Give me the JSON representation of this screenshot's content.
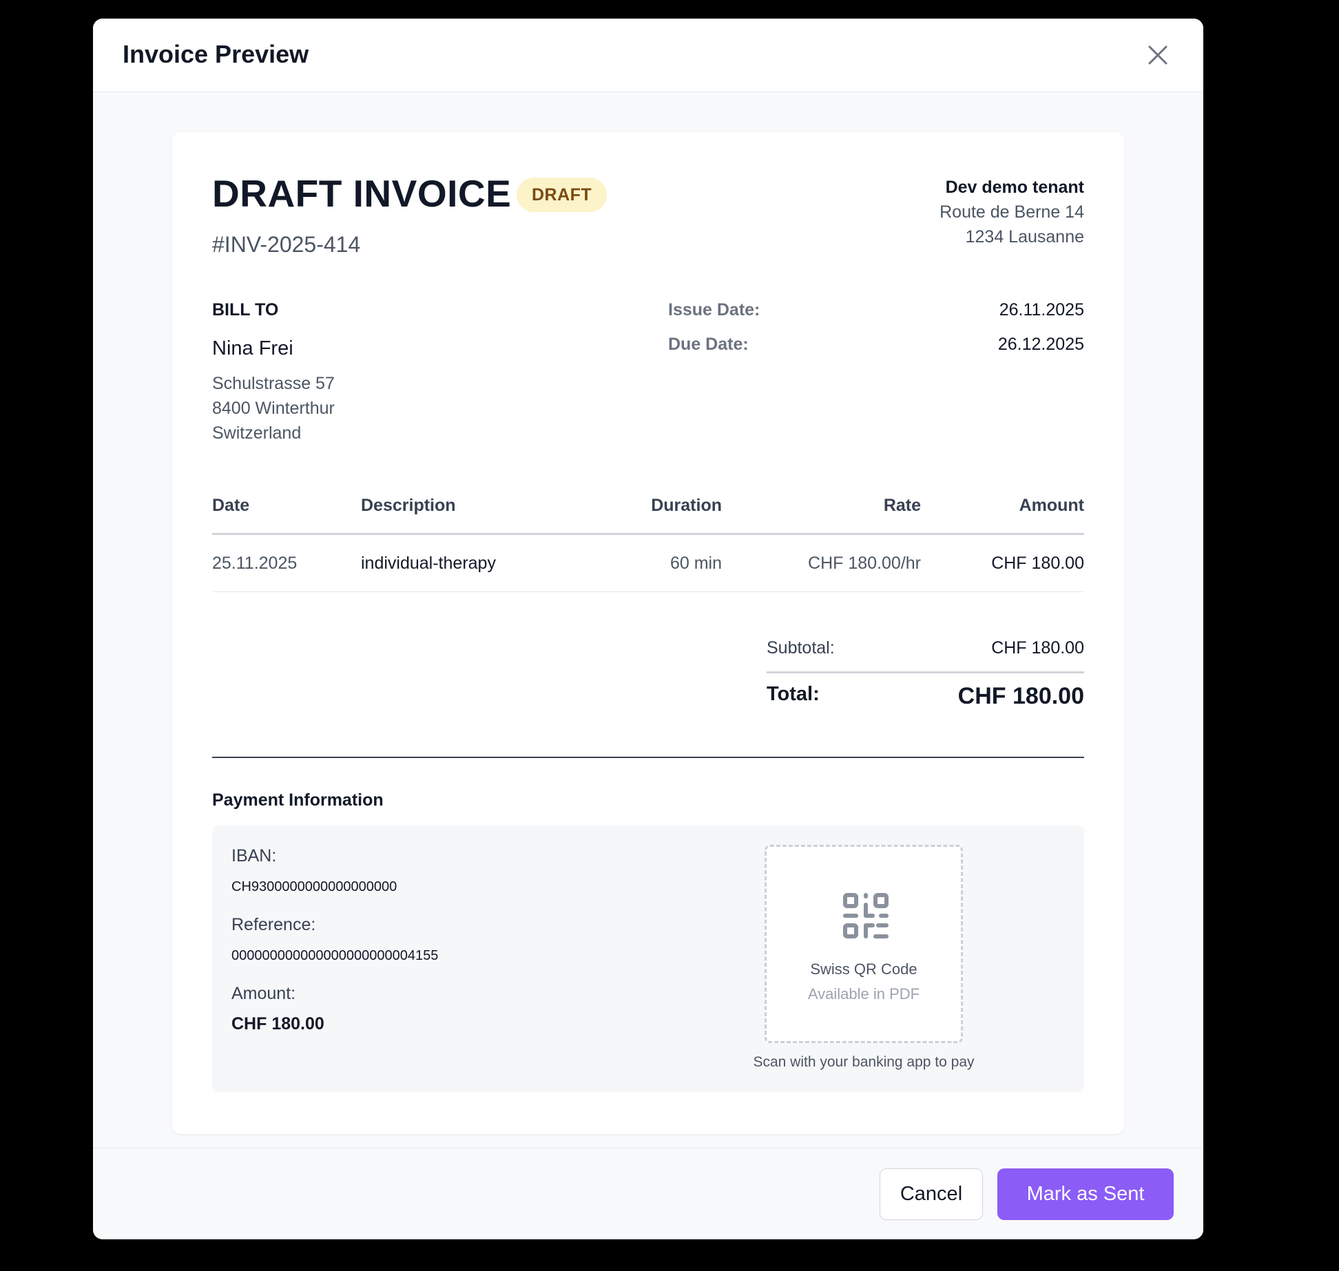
{
  "modal": {
    "title": "Invoice Preview",
    "close_icon": "close-icon"
  },
  "invoice": {
    "title": "DRAFT INVOICE",
    "status_badge": "DRAFT",
    "number": "#INV-2025-414",
    "tenant": {
      "name": "Dev demo tenant",
      "street": "Route de Berne 14",
      "city": "1234 Lausanne"
    },
    "bill_to": {
      "label": "BILL TO",
      "name": "Nina Frei",
      "street": "Schulstrasse 57",
      "city": "8400 Winterthur",
      "country": "Switzerland"
    },
    "dates": {
      "issue_label": "Issue Date:",
      "issue_value": "26.11.2025",
      "due_label": "Due Date:",
      "due_value": "26.12.2025"
    },
    "table": {
      "headers": [
        "Date",
        "Description",
        "Duration",
        "Rate",
        "Amount"
      ],
      "rows": [
        {
          "date": "25.11.2025",
          "description": "individual-therapy",
          "duration": "60 min",
          "rate": "CHF 180.00/hr",
          "amount": "CHF 180.00"
        }
      ]
    },
    "summary": {
      "subtotal_label": "Subtotal:",
      "subtotal_value": "CHF 180.00",
      "total_label": "Total:",
      "total_value": "CHF 180.00"
    },
    "payment": {
      "title": "Payment Information",
      "iban_label": "IBAN:",
      "iban_value": "CH9300000000000000000",
      "reference_label": "Reference:",
      "reference_value": "000000000000000000000004155",
      "amount_label": "Amount:",
      "amount_value": "CHF 180.00",
      "qr_title": "Swiss QR Code",
      "qr_subtitle": "Available in PDF",
      "qr_caption": "Scan with your banking app to pay"
    }
  },
  "footer": {
    "cancel_label": "Cancel",
    "mark_sent_label": "Mark as Sent"
  },
  "colors": {
    "accent": "#8b5cf6",
    "badge_bg": "#fdf3c8",
    "badge_text": "#7a4a12"
  }
}
